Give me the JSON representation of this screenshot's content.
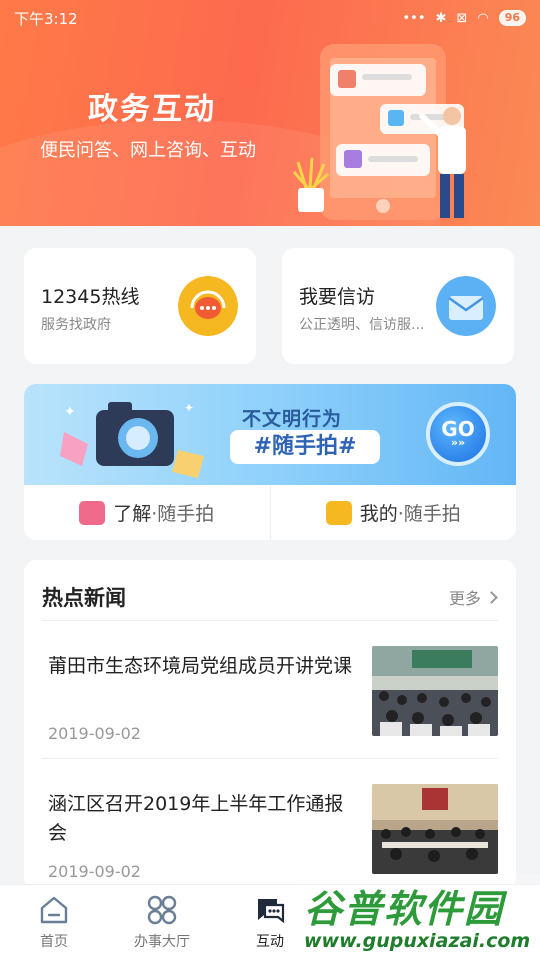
{
  "status_bar": {
    "time": "下午3:12",
    "battery": "96"
  },
  "header": {
    "title": "政务互动",
    "subtitle": "便民问答、网上咨询、互动"
  },
  "services": [
    {
      "title": "12345热线",
      "desc": "服务找政府",
      "icon": "hotline-chat-icon",
      "color": "#f6b820"
    },
    {
      "title": "我要信访",
      "desc": "公正透明、信访服...",
      "icon": "envelope-icon",
      "color": "#4fa7ef"
    }
  ],
  "banner": {
    "line1": "不文明行为",
    "line2": "#随手拍#",
    "go_label": "GO",
    "go_sub": "»»"
  },
  "actions": [
    {
      "strong": "了解",
      "light": "·随手拍",
      "icon": "camera-icon",
      "color": "#f06a8c"
    },
    {
      "strong": "我的",
      "light": "·随手拍",
      "icon": "flag-icon",
      "color": "#f6b820"
    }
  ],
  "news": {
    "heading": "热点新闻",
    "more_label": "更多",
    "items": [
      {
        "title": "莆田市生态环境局党组成员开讲党课",
        "date": "2019-09-02"
      },
      {
        "title": "涵江区召开2019年上半年工作通报会",
        "date": "2019-09-02"
      }
    ]
  },
  "tabs": [
    {
      "label": "首页",
      "icon": "home-icon"
    },
    {
      "label": "办事大厅",
      "icon": "grid-icon"
    },
    {
      "label": "互动",
      "icon": "chat-icon",
      "active": true
    }
  ],
  "watermark": {
    "name": "谷普软件园",
    "url": "www.gupuxiazai.com"
  }
}
